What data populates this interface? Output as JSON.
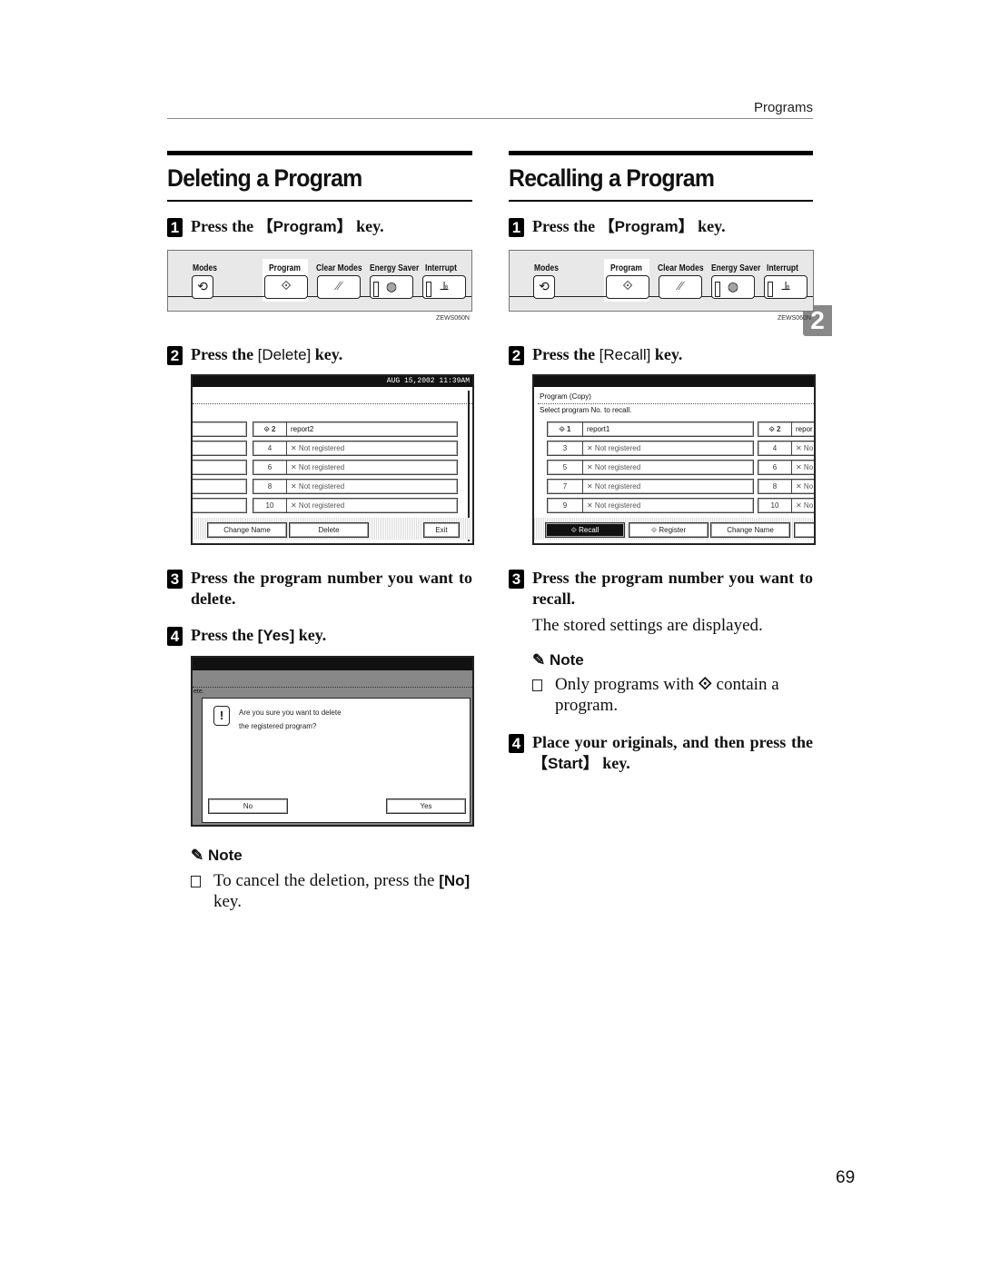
{
  "running_head": "Programs",
  "chapter_tab": "2",
  "page_number": "69",
  "left": {
    "title": "Deleting a Program",
    "steps": [
      {
        "num": "1",
        "pre": "Press the ",
        "key": "【Program】",
        "post": " key."
      },
      {
        "num": "2",
        "pre": "Press the ",
        "key": "[Delete]",
        "post": " key."
      },
      {
        "num": "3",
        "text": "Press the program number you want to delete."
      },
      {
        "num": "4",
        "pre": "Press the ",
        "key": "[Yes]",
        "post": " key."
      }
    ],
    "note": {
      "heading": "Note",
      "items": [
        {
          "pre": "To cancel the deletion, press the ",
          "key": "[No]",
          "post": " key."
        }
      ]
    },
    "delete_screen": {
      "datetime": "AUG  15,2002 11:39AM",
      "rows": [
        {
          "num": "2",
          "name": "report2",
          "icon": "program-stored"
        },
        {
          "num": "4",
          "name": "Not registered",
          "icon": "not-registered"
        },
        {
          "num": "6",
          "name": "Not registered",
          "icon": "not-registered"
        },
        {
          "num": "8",
          "name": "Not registered",
          "icon": "not-registered"
        },
        {
          "num": "10",
          "name": "Not registered",
          "icon": "not-registered"
        }
      ],
      "buttons": {
        "change_name": "Change Name",
        "delete": "Delete",
        "exit": "Exit"
      }
    },
    "confirm_screen": {
      "partial_label": "ete.",
      "message_line1": "Are you sure you want to delete",
      "message_line2": "the registered program?",
      "no": "No",
      "yes": "Yes"
    }
  },
  "right": {
    "title": "Recalling a Program",
    "steps": [
      {
        "num": "1",
        "pre": "Press the ",
        "key": "【Program】",
        "post": " key."
      },
      {
        "num": "2",
        "pre": "Press the ",
        "key": "[Recall]",
        "post": " key."
      },
      {
        "num": "3",
        "text": "Press the program number you want to recall."
      },
      {
        "num": "4",
        "pre": "Place your originals, and then press the ",
        "key": "【Start】",
        "post": " key."
      }
    ],
    "step3_detail": "The stored settings are displayed.",
    "note": {
      "heading": "Note",
      "items": [
        {
          "pre": "Only programs with ",
          "icon": "program-stored-icon",
          "post": " contain a program."
        }
      ]
    },
    "recall_screen": {
      "title": "Program (Copy)",
      "instruction": "Select program No. to recall.",
      "left_rows": [
        {
          "num": "1",
          "name": "report1",
          "icon": "program-stored"
        },
        {
          "num": "3",
          "name": "Not registered",
          "icon": "not-registered"
        },
        {
          "num": "5",
          "name": "Not registered",
          "icon": "not-registered"
        },
        {
          "num": "7",
          "name": "Not registered",
          "icon": "not-registered"
        },
        {
          "num": "9",
          "name": "Not registered",
          "icon": "not-registered"
        }
      ],
      "right_rows": [
        {
          "num": "2",
          "name": "repor",
          "icon": "program-stored"
        },
        {
          "num": "4",
          "name": "No",
          "icon": "not-registered"
        },
        {
          "num": "6",
          "name": "No",
          "icon": "not-registered"
        },
        {
          "num": "8",
          "name": "No",
          "icon": "not-registered"
        },
        {
          "num": "10",
          "name": "No",
          "icon": "not-registered"
        }
      ],
      "buttons": {
        "recall": "Recall",
        "register": "Register",
        "change_name": "Change Name"
      }
    }
  },
  "control_panel": {
    "labels": {
      "modes": "Modes",
      "program": "Program",
      "clear_modes": "Clear Modes",
      "energy_saver": "Energy Saver",
      "interrupt": "Interrupt"
    },
    "figure_code": "ZEWS060N"
  }
}
